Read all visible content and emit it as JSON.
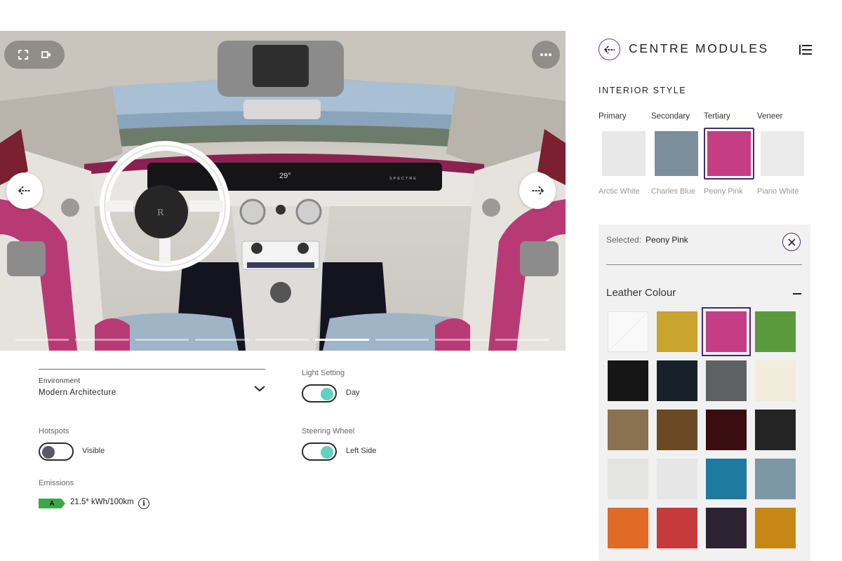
{
  "viewer": {
    "controls": {
      "fullscreen_icon": "fullscreen-icon",
      "video_icon": "video-camera-icon",
      "more_icon": "more-dots-icon"
    },
    "prev_icon": "arrow-left-icon",
    "next_icon": "arrow-right-icon",
    "progress": {
      "segments": 9,
      "active_index": 5
    },
    "screen_temp": "29°",
    "screen_brand": "SPECTRE"
  },
  "settings": {
    "environment": {
      "label": "Environment",
      "value": "Modern Architecture"
    },
    "light": {
      "label": "Light Setting",
      "value": "Day",
      "on": true
    },
    "hotspots": {
      "label": "Hotspots",
      "value": "Visible",
      "on": false
    },
    "steering": {
      "label": "Steering Wheel",
      "value": "Left Side",
      "on": true
    },
    "emissions": {
      "label": "Emissions",
      "rating": "A",
      "value": "21.5* kWh/100km"
    }
  },
  "panel": {
    "title": "CENTRE MODULES",
    "section": "INTERIOR STYLE",
    "styles": [
      {
        "category": "Primary",
        "name": "Arctic White",
        "color": "#e8e8e8",
        "selected": false
      },
      {
        "category": "Secondary",
        "name": "Charles Blue",
        "color": "#7a8e9c",
        "selected": false
      },
      {
        "category": "Tertiary",
        "name": "Peony Pink",
        "color": "#c43d85",
        "selected": true
      },
      {
        "category": "Veneer",
        "name": "Piano White",
        "color": "#ebebeb",
        "selected": false
      }
    ],
    "selected_label": "Selected:",
    "selected_value": "Peony Pink",
    "leather_title": "Leather Colour",
    "leather_colors": [
      "#f8f8f8",
      "#c9a42e",
      "#c43d85",
      "#5a9a3c",
      "#161616",
      "#172029",
      "#5e6164",
      "#f2ecdc",
      "#8a7150",
      "#6a4a24",
      "#3a0d10",
      "#242424",
      "#e4e4e0",
      "#e6e6e6",
      "#1e7aa0",
      "#7e97a6",
      "#e06a26",
      "#c63a3e",
      "#2c2232",
      "#c78616"
    ],
    "leather_selected_index": 2
  }
}
